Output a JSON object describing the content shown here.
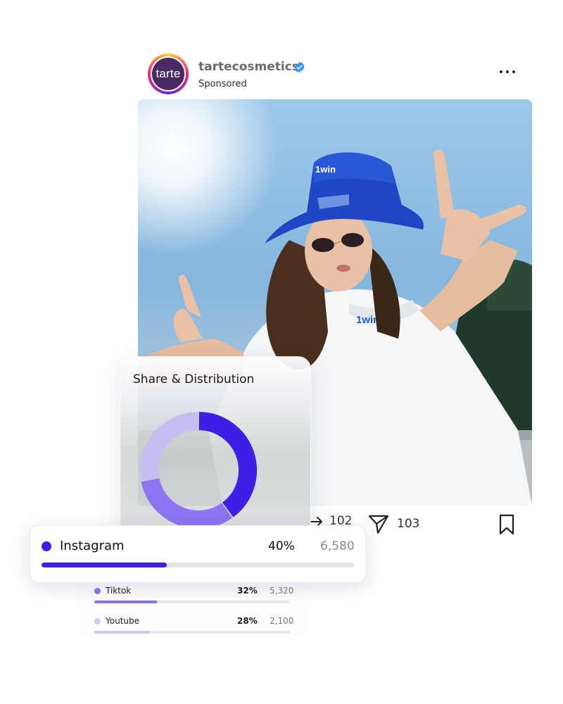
{
  "post": {
    "avatar_text": "tarte",
    "username": "tartecosmetics",
    "sponsored_label": "Sponsored",
    "image_text": {
      "hat_logo": "1win",
      "shirt_logo": "1win"
    },
    "actions": {
      "share_count": "102",
      "send_count": "103"
    }
  },
  "distribution": {
    "title": "Share & Distribution"
  },
  "chart_data": {
    "type": "pie",
    "title": "Share & Distribution",
    "categories": [
      "Instagram",
      "Tiktok",
      "Youtube"
    ],
    "values": [
      40,
      32,
      28
    ],
    "counts": [
      6580,
      5320,
      2100
    ],
    "colors": [
      "#3f1fe8",
      "#8c74f2",
      "#c7bdf0"
    ],
    "donut": true
  },
  "platforms": [
    {
      "name": "Instagram",
      "pct": "40%",
      "value": "6,580",
      "share": 0.4,
      "color": "#3f1fe8"
    },
    {
      "name": "Tiktok",
      "pct": "32%",
      "value": "5,320",
      "share": 0.32,
      "color": "#8a6ff0"
    },
    {
      "name": "Youtube",
      "pct": "28%",
      "value": "2,100",
      "share": 0.28,
      "color": "#d0c8ee"
    }
  ],
  "colors": {
    "accent": "#3f1fe8",
    "verified": "#3897f0"
  },
  "icons": [
    "more-dots-icon",
    "verified-badge-icon",
    "share-arrow-icon",
    "send-icon",
    "bookmark-icon"
  ]
}
